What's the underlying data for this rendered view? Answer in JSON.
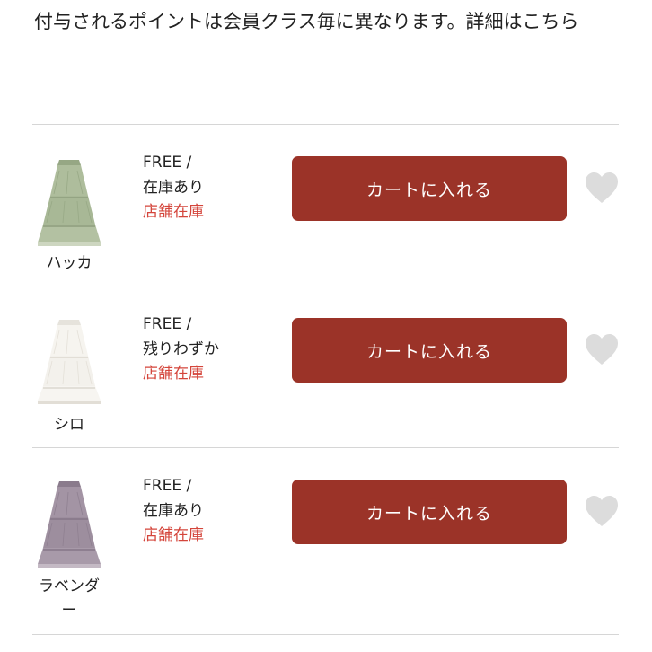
{
  "notice": {
    "text": "付与されるポイントは会員クラス毎に異なります。詳細はこちら"
  },
  "items": [
    {
      "color_name": "ハッカ",
      "size": "FREE /",
      "stock": "在庫あり",
      "store_stock": "店舗在庫",
      "cart_label": "カートに入れる",
      "favorite_icon": "heart-icon",
      "skirt_color": "#a8b896"
    },
    {
      "color_name": "シロ",
      "size": "FREE /",
      "stock": "残りわずか",
      "store_stock": "店舗在庫",
      "cart_label": "カートに入れる",
      "favorite_icon": "heart-icon",
      "skirt_color": "#f3f1ec"
    },
    {
      "color_name": "ラベンダー",
      "size": "FREE /",
      "stock": "在庫あり",
      "store_stock": "店舗在庫",
      "cart_label": "カートに入れる",
      "favorite_icon": "heart-icon",
      "skirt_color": "#9d8e9e"
    }
  ],
  "colors": {
    "cart_button": "#9b3328",
    "store_stock_text": "#d4453b",
    "heart": "#dcdcdc",
    "divider": "#d6d6d6"
  }
}
